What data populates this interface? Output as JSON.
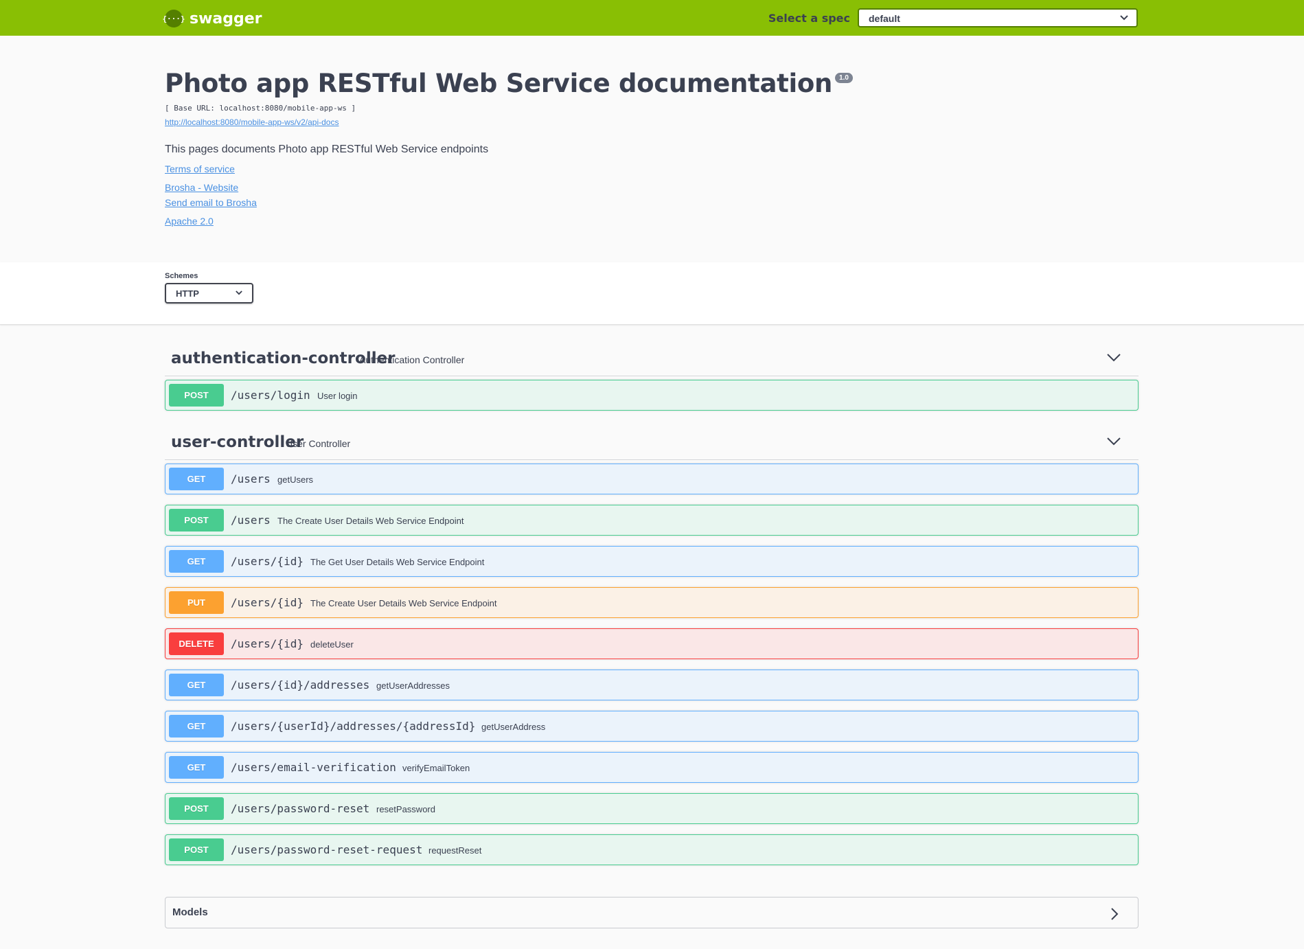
{
  "topbar": {
    "logo_icon": "{···}",
    "logo_text": "swagger",
    "spec_label": "Select a spec",
    "spec_value": "default"
  },
  "info": {
    "title": "Photo app RESTful Web Service documentation",
    "version": "1.0",
    "base_url": "[ Base URL: localhost:8080/mobile-app-ws ]",
    "api_docs_url": "http://localhost:8080/mobile-app-ws/v2/api-docs",
    "description": "This pages documents Photo app RESTful Web Service endpoints",
    "terms": "Terms of service",
    "website": "Brosha - Website",
    "email": "Send email to Brosha",
    "license": "Apache 2.0"
  },
  "schemes": {
    "label": "Schemes",
    "value": "HTTP"
  },
  "tags": [
    {
      "name": "authentication-controller",
      "description": "Authentication Controller",
      "operations": [
        {
          "method": "POST",
          "path": "/users/login",
          "summary": "User login"
        }
      ]
    },
    {
      "name": "user-controller",
      "description": "User Controller",
      "operations": [
        {
          "method": "GET",
          "path": "/users",
          "summary": "getUsers"
        },
        {
          "method": "POST",
          "path": "/users",
          "summary": "The Create User Details Web Service Endpoint"
        },
        {
          "method": "GET",
          "path": "/users/{id}",
          "summary": "The Get User Details Web Service Endpoint"
        },
        {
          "method": "PUT",
          "path": "/users/{id}",
          "summary": "The Create User Details Web Service Endpoint"
        },
        {
          "method": "DELETE",
          "path": "/users/{id}",
          "summary": "deleteUser"
        },
        {
          "method": "GET",
          "path": "/users/{id}/addresses",
          "summary": "getUserAddresses"
        },
        {
          "method": "GET",
          "path": "/users/{userId}/addresses/{addressId}",
          "summary": "getUserAddress"
        },
        {
          "method": "GET",
          "path": "/users/email-verification",
          "summary": "verifyEmailToken"
        },
        {
          "method": "POST",
          "path": "/users/password-reset",
          "summary": "resetPassword"
        },
        {
          "method": "POST",
          "path": "/users/password-reset-request",
          "summary": "requestReset"
        }
      ]
    }
  ],
  "models": {
    "title": "Models"
  },
  "colors": {
    "topbar": "#89bf04",
    "get": "#61affe",
    "post": "#49cc90",
    "put": "#fca130",
    "delete": "#f93e3e"
  },
  "icons": {
    "spec_dropdown": "chevron-down-icon",
    "schemes_dropdown": "chevron-down-icon",
    "tag_toggle": "chevron-down-icon",
    "models_toggle": "chevron-right-icon",
    "logo": "swagger-logo-icon"
  }
}
